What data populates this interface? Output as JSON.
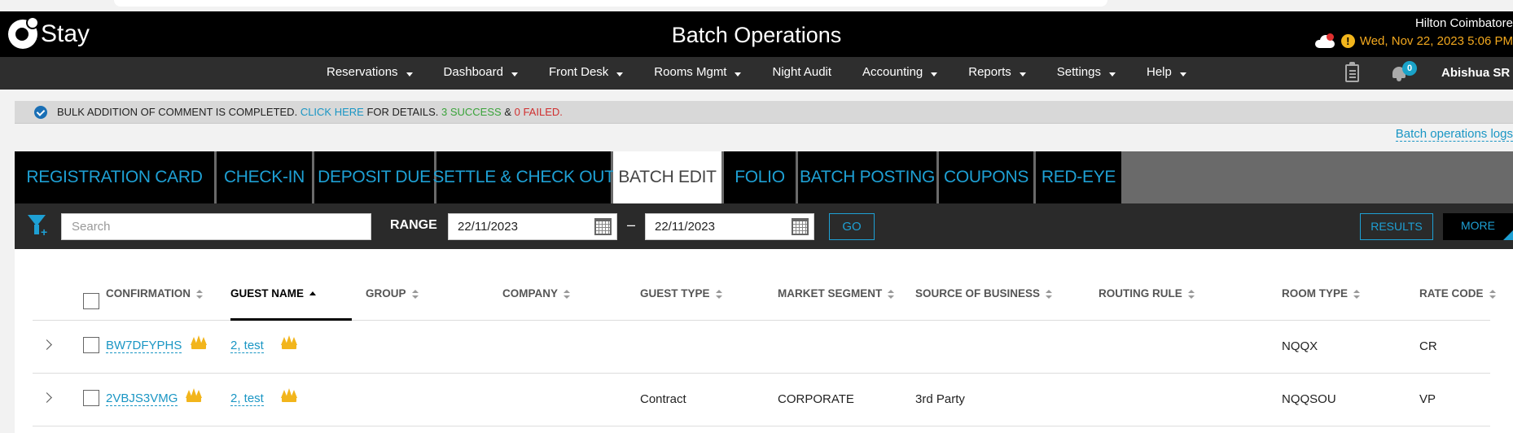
{
  "app": {
    "logo_text": "Stay",
    "page_title": "Batch Operations",
    "hotel_name": "Hilton Coimbatore",
    "datetime": "Wed, Nov 22, 2023 5:06 PM"
  },
  "nav": {
    "items": [
      {
        "label": "Reservations",
        "has_menu": true
      },
      {
        "label": "Dashboard",
        "has_menu": true
      },
      {
        "label": "Front Desk",
        "has_menu": true
      },
      {
        "label": "Rooms Mgmt",
        "has_menu": true
      },
      {
        "label": "Night Audit",
        "has_menu": false
      },
      {
        "label": "Accounting",
        "has_menu": true
      },
      {
        "label": "Reports",
        "has_menu": true
      },
      {
        "label": "Settings",
        "has_menu": true
      },
      {
        "label": "Help",
        "has_menu": true
      }
    ],
    "notification_count": "0",
    "user_name": "Abishua SR"
  },
  "notice": {
    "prefix": "BULK ADDITION OF COMMENT IS COMPLETED.",
    "link": "CLICK HERE",
    "middle": "FOR DETAILS.",
    "success": "3 SUCCESS",
    "amp": "&",
    "failed": "0 FAILED."
  },
  "batch_logs_link": "Batch operations logs",
  "tabs": [
    {
      "label": "REGISTRATION CARD",
      "active": false
    },
    {
      "label": "CHECK-IN",
      "active": false
    },
    {
      "label": "DEPOSIT DUE",
      "active": false
    },
    {
      "label": "SETTLE & CHECK OUT",
      "active": false
    },
    {
      "label": "BATCH EDIT",
      "active": true
    },
    {
      "label": "FOLIO",
      "active": false
    },
    {
      "label": "BATCH POSTING",
      "active": false
    },
    {
      "label": "COUPONS",
      "active": false
    },
    {
      "label": "RED-EYE",
      "active": false
    }
  ],
  "filter": {
    "search_placeholder": "Search",
    "range_label": "RANGE",
    "date_from": "22/11/2023",
    "date_to": "22/11/2023",
    "dash": "–",
    "go_label": "GO",
    "results_label": "RESULTS",
    "more_label": "MORE"
  },
  "table": {
    "columns": [
      {
        "key": "confirmation",
        "label": "CONFIRMATION"
      },
      {
        "key": "guest_name",
        "label": "GUEST NAME"
      },
      {
        "key": "group",
        "label": "GROUP"
      },
      {
        "key": "company",
        "label": "COMPANY"
      },
      {
        "key": "guest_type",
        "label": "GUEST TYPE"
      },
      {
        "key": "market_segment",
        "label": "MARKET SEGMENT"
      },
      {
        "key": "source_of_business",
        "label": "SOURCE OF BUSINESS"
      },
      {
        "key": "routing_rule",
        "label": "ROUTING RULE"
      },
      {
        "key": "room_type",
        "label": "ROOM TYPE"
      },
      {
        "key": "rate_code",
        "label": "RATE CODE"
      }
    ],
    "rows": [
      {
        "confirmation": "BW7DFYPHS",
        "guest_name": "2, test",
        "guest_type": "",
        "market_segment": "",
        "source_of_business": "",
        "room_type": "NQQX",
        "rate_code": "CR"
      },
      {
        "confirmation": "2VBJS3VMG",
        "guest_name": "2, test",
        "guest_type": "Contract",
        "market_segment": "CORPORATE",
        "source_of_business": "3rd Party",
        "room_type": "NQQSOU",
        "rate_code": "VP"
      }
    ]
  }
}
